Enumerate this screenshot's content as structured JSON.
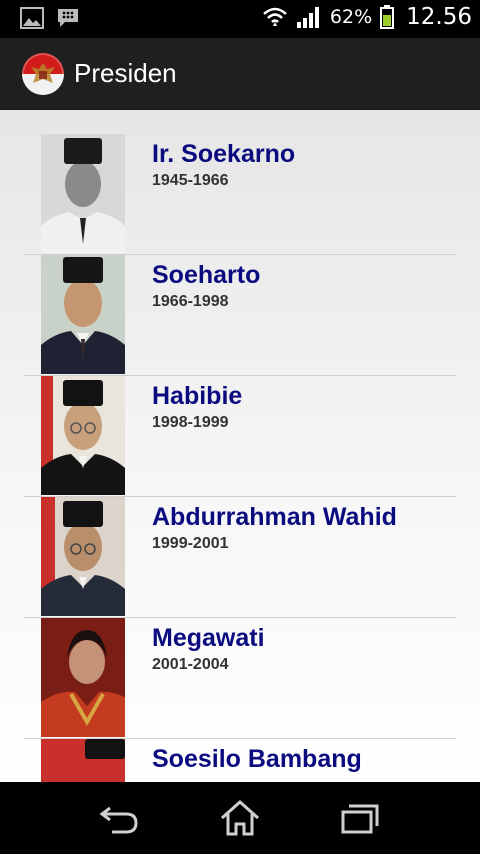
{
  "status_bar": {
    "battery_percent": "62%",
    "time": "12.56"
  },
  "action_bar": {
    "title": "Presiden"
  },
  "presidents": [
    {
      "name": "Ir. Soekarno",
      "years": "1945-1966"
    },
    {
      "name": "Soeharto",
      "years": "1966-1998"
    },
    {
      "name": "Habibie",
      "years": "1998-1999"
    },
    {
      "name": "Abdurrahman Wahid",
      "years": "1999-2001"
    },
    {
      "name": "Megawati",
      "years": "2001-2004"
    },
    {
      "name": "Soesilo Bambang",
      "years": ""
    }
  ],
  "colors": {
    "name_text": "#0b0b80",
    "years_text": "#333333",
    "action_bar_bg": "#1f1f1f"
  }
}
